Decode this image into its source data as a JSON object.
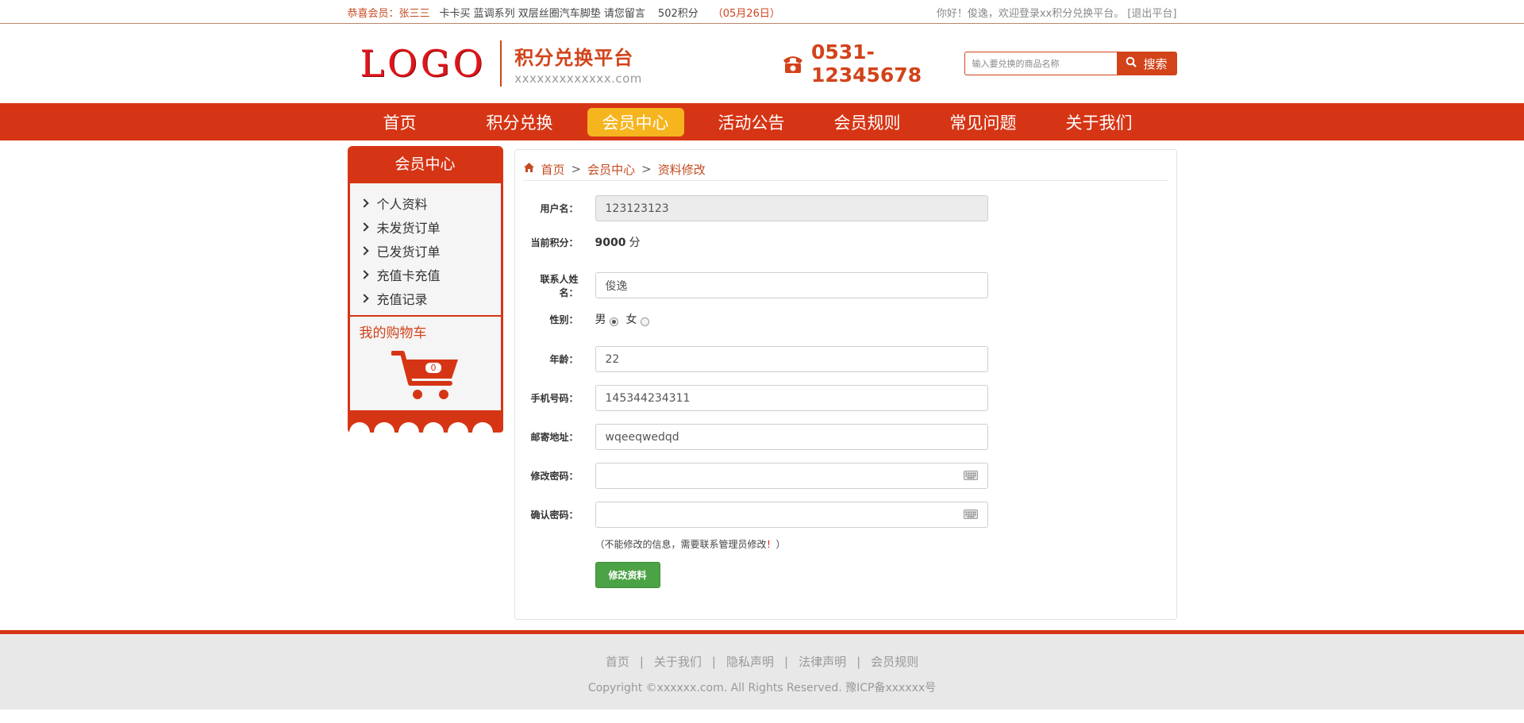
{
  "topbar": {
    "member": "恭喜会员：张三三",
    "promo": "卡卡买 蓝调系列 双层丝圈汽车脚垫 请您留言",
    "points": "502积分",
    "date": "（05月26日）",
    "greeting": "你好！俊逸，欢迎登录xx积分兑换平台。",
    "logout": "[退出平台]"
  },
  "header": {
    "logo": "LOGO",
    "brand": "积分兑换平台",
    "domain": "xxxxxxxxxxxxx.com",
    "phone": "0531-12345678",
    "search_placeholder": "输入要兑换的商品名称",
    "search_button": "搜索"
  },
  "nav": {
    "items": [
      "首页",
      "积分兑换",
      "会员中心",
      "活动公告",
      "会员规则",
      "常见问题",
      "关于我们"
    ],
    "active": "会员中心"
  },
  "sidebar": {
    "title": "会员中心",
    "menu": [
      "个人资料",
      "未发货订单",
      "已发货订单",
      "充值卡充值",
      "充值记录"
    ],
    "cart_title": "我的购物车",
    "cart_count": "0"
  },
  "breadcrumb": [
    "首页",
    "会员中心",
    "资料修改"
  ],
  "form": {
    "username_label": "用户名：",
    "username_value": "123123123",
    "points_label": "当前积分：",
    "points_value": "9000",
    "points_unit": "分",
    "contact_label": "联系人姓名：",
    "contact_value": "俊逸",
    "gender_label": "性别：",
    "gender_male": "男",
    "gender_female": "女",
    "age_label": "年龄：",
    "age_value": "22",
    "phone_label": "手机号码：",
    "phone_value": "145344234311",
    "address_label": "邮寄地址：",
    "address_value": "wqeeqwedqd",
    "password_label": "修改密码：",
    "confirm_label": "确认密码：",
    "note_pre": "（不能修改的信息，需要联系管理员修改",
    "note_ex": "！",
    "note_post": "）",
    "submit": "修改资料"
  },
  "footer": {
    "links": [
      "首页",
      "关于我们",
      "隐私声明",
      "法律声明",
      "会员规则"
    ],
    "copyright": "Copyright ©xxxxxx.com. All Rights Reserved. 豫ICP备xxxxxx号"
  },
  "colors": {
    "primary": "#d63515",
    "active_nav": "#f6b41e",
    "submit": "#4ca346"
  }
}
